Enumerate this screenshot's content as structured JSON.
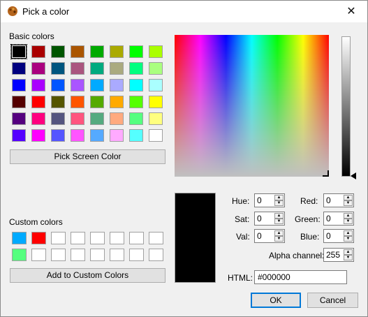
{
  "window": {
    "title": "Pick a color",
    "close_glyph": "✕"
  },
  "basic": {
    "label": "Basic colors",
    "colors": [
      "#000000",
      "#aa0000",
      "#005500",
      "#aa5500",
      "#00aa00",
      "#aaaa00",
      "#00ff00",
      "#aaff00",
      "#00007f",
      "#aa007f",
      "#00557f",
      "#aa557f",
      "#00aa7f",
      "#aaaa7f",
      "#00ff7f",
      "#aaff7f",
      "#0000ff",
      "#aa00ff",
      "#0055ff",
      "#aa55ff",
      "#00aaff",
      "#aaaaff",
      "#00ffff",
      "#aaffff",
      "#550000",
      "#ff0000",
      "#555500",
      "#ff5500",
      "#55aa00",
      "#ffaa00",
      "#55ff00",
      "#ffff00",
      "#55007f",
      "#ff007f",
      "#55557f",
      "#ff557f",
      "#55aa7f",
      "#ffaa7f",
      "#55ff7f",
      "#ffff7f",
      "#5500ff",
      "#ff00ff",
      "#5555ff",
      "#ff55ff",
      "#55aaff",
      "#ffaaff",
      "#55ffff",
      "#ffffff"
    ]
  },
  "pick_screen_label": "Pick Screen Color",
  "custom": {
    "label": "Custom colors",
    "colors": [
      "#00aaff",
      "#ff0000",
      "#ffffff",
      "#ffffff",
      "#ffffff",
      "#ffffff",
      "#ffffff",
      "#ffffff",
      "#55ff7f",
      "#ffffff",
      "#ffffff",
      "#ffffff",
      "#ffffff",
      "#ffffff",
      "#ffffff",
      "#ffffff"
    ]
  },
  "add_custom_label": "Add to Custom Colors",
  "preview_color": "#000000",
  "fields": {
    "hue": {
      "label": "Hue:",
      "value": "0"
    },
    "sat": {
      "label": "Sat:",
      "value": "0"
    },
    "val": {
      "label": "Val:",
      "value": "0"
    },
    "red": {
      "label": "Red:",
      "value": "0"
    },
    "green": {
      "label": "Green:",
      "value": "0"
    },
    "blue": {
      "label": "Blue:",
      "value": "0"
    },
    "alpha": {
      "label": "Alpha channel:",
      "value": "255"
    },
    "html": {
      "label": "HTML:",
      "value": "#000000"
    }
  },
  "buttons": {
    "ok": "OK",
    "cancel": "Cancel"
  },
  "icons": {
    "app": "color-palette-icon",
    "close": "close-icon"
  }
}
